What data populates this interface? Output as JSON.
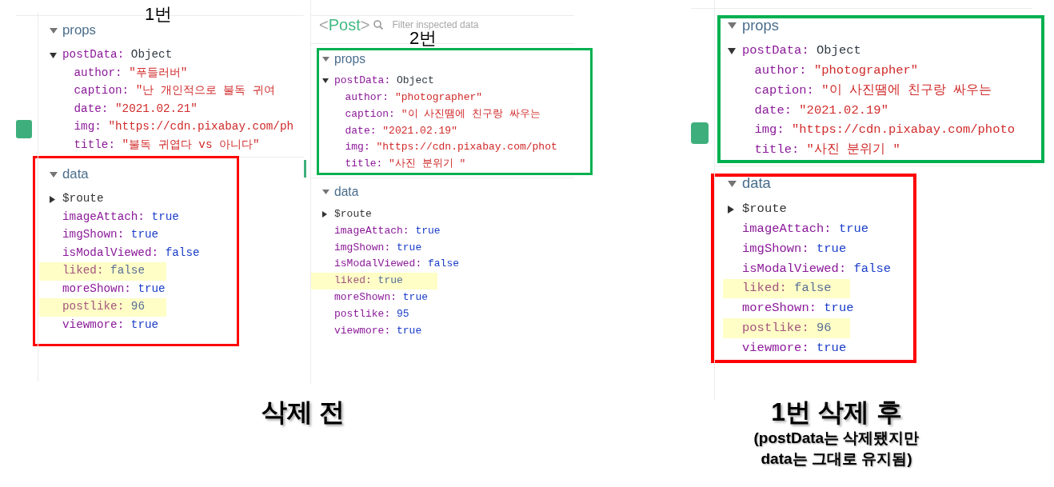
{
  "panels": [
    {
      "number_label": "1번",
      "sections": [
        {
          "title": "props",
          "expanded": true,
          "rows": [
            {
              "kind": "object",
              "key": "postData:",
              "value": "Object",
              "expanded": true,
              "children": [
                {
                  "kind": "string",
                  "key": "author:",
                  "value": "\"푸들러버\""
                },
                {
                  "kind": "string",
                  "key": "caption:",
                  "value": "\"난 개인적으로 불독 귀여"
                },
                {
                  "kind": "string",
                  "key": "date:",
                  "value": "\"2021.02.21\""
                },
                {
                  "kind": "string",
                  "key": "img:",
                  "value": "\"https://cdn.pixabay.com/ph"
                },
                {
                  "kind": "string",
                  "key": "title:",
                  "value": "\"불독 귀엽다 vs 아니다\""
                }
              ]
            }
          ]
        },
        {
          "title": "data",
          "expanded": true,
          "color": "#ff0000",
          "rows": [
            {
              "kind": "group",
              "key": "$route",
              "expanded": false,
              "highlighted": false
            },
            {
              "kind": "literal",
              "key": "imageAttach:",
              "value": "true",
              "highlighted": false
            },
            {
              "kind": "literal",
              "key": "imgShown:",
              "value": "true",
              "highlighted": false
            },
            {
              "kind": "literal",
              "key": "isModalViewed:",
              "value": "false",
              "highlighted": false
            },
            {
              "kind": "literal",
              "key": "liked:",
              "value": "false",
              "highlighted": true
            },
            {
              "kind": "literal",
              "key": "moreShown:",
              "value": "true",
              "highlighted": false
            },
            {
              "kind": "literal",
              "key": "postlike:",
              "value": "96",
              "highlighted": true
            },
            {
              "kind": "literal",
              "key": "viewmore:",
              "value": "true",
              "highlighted": false
            }
          ]
        }
      ]
    },
    {
      "inspector_header": {
        "tag_open": "<",
        "component": "Post",
        "tag_close": ">",
        "filter_placeholder": "Filter inspected data"
      },
      "number_label": "2번",
      "sections": [
        {
          "title": "props",
          "expanded": true,
          "color": "#00b050",
          "rows": [
            {
              "kind": "object",
              "key": "postData:",
              "value": "Object",
              "expanded": true,
              "children": [
                {
                  "kind": "string",
                  "key": "author:",
                  "value": "\"photographer\""
                },
                {
                  "kind": "string",
                  "key": "caption:",
                  "value": "\"이 사진땜에 친구랑 싸우는"
                },
                {
                  "kind": "string",
                  "key": "date:",
                  "value": "\"2021.02.19\""
                },
                {
                  "kind": "string",
                  "key": "img:",
                  "value": "\"https://cdn.pixabay.com/phot"
                },
                {
                  "kind": "string",
                  "key": "title:",
                  "value": "\"사진 분위기 \""
                }
              ]
            }
          ]
        },
        {
          "title": "data",
          "expanded": true,
          "rows": [
            {
              "kind": "group",
              "key": "$route",
              "expanded": false,
              "highlighted": false
            },
            {
              "kind": "literal",
              "key": "imageAttach:",
              "value": "true",
              "highlighted": false
            },
            {
              "kind": "literal",
              "key": "imgShown:",
              "value": "true",
              "highlighted": false
            },
            {
              "kind": "literal",
              "key": "isModalViewed:",
              "value": "false",
              "highlighted": false
            },
            {
              "kind": "literal",
              "key": "liked:",
              "value": "true",
              "highlighted": true
            },
            {
              "kind": "literal",
              "key": "moreShown:",
              "value": "true",
              "highlighted": false
            },
            {
              "kind": "literal",
              "key": "postlike:",
              "value": "95",
              "highlighted": false
            },
            {
              "kind": "literal",
              "key": "viewmore:",
              "value": "true",
              "highlighted": false
            }
          ]
        }
      ]
    },
    {
      "sections": [
        {
          "title": "props",
          "expanded": true,
          "color": "#00b050",
          "rows": [
            {
              "kind": "object",
              "key": "postData:",
              "value": "Object",
              "expanded": true,
              "children": [
                {
                  "kind": "string",
                  "key": "author:",
                  "value": "\"photographer\""
                },
                {
                  "kind": "string",
                  "key": "caption:",
                  "value": "\"이 사진땜에 친구랑 싸우는"
                },
                {
                  "kind": "string",
                  "key": "date:",
                  "value": "\"2021.02.19\""
                },
                {
                  "kind": "string",
                  "key": "img:",
                  "value": "\"https://cdn.pixabay.com/photo"
                },
                {
                  "kind": "string",
                  "key": "title:",
                  "value": "\"사진 분위기 \""
                }
              ]
            }
          ]
        },
        {
          "title": "data",
          "expanded": true,
          "color": "#ff0000",
          "rows": [
            {
              "kind": "group",
              "key": "$route",
              "expanded": false,
              "highlighted": false
            },
            {
              "kind": "literal",
              "key": "imageAttach:",
              "value": "true",
              "highlighted": false
            },
            {
              "kind": "literal",
              "key": "imgShown:",
              "value": "true",
              "highlighted": false
            },
            {
              "kind": "literal",
              "key": "isModalViewed:",
              "value": "false",
              "highlighted": false
            },
            {
              "kind": "literal",
              "key": "liked:",
              "value": "false",
              "highlighted": true
            },
            {
              "kind": "literal",
              "key": "moreShown:",
              "value": "true",
              "highlighted": false
            },
            {
              "kind": "literal",
              "key": "postlike:",
              "value": "96",
              "highlighted": true
            },
            {
              "kind": "literal",
              "key": "viewmore:",
              "value": "true",
              "highlighted": false
            }
          ]
        }
      ]
    }
  ],
  "captions": [
    {
      "title": "삭제 전"
    },
    {
      "title": "1번 삭제 후",
      "note": "(postData는 삭제됐지만\ndata는 그대로 유지됨)"
    }
  ]
}
